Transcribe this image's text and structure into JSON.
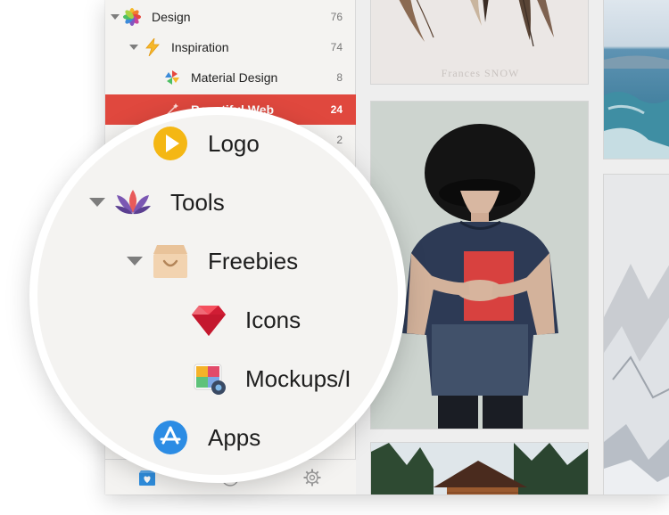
{
  "sidebar": {
    "items": [
      {
        "label": "Design",
        "count": "76",
        "icon": "photos-flower-icon"
      },
      {
        "label": "Inspiration",
        "count": "74",
        "icon": "lightning-icon"
      },
      {
        "label": "Material Design",
        "count": "8",
        "icon": "pinwheel-icon"
      },
      {
        "label": "Beautiful Web",
        "count": "24",
        "icon": "wand-icon",
        "selected": true
      },
      {
        "label": "",
        "count": "2",
        "icon": ""
      }
    ],
    "tabs": [
      {
        "name": "favorites-tab",
        "icon": "heart-box-icon"
      },
      {
        "name": "downloads-tab",
        "icon": "download-circle-icon"
      },
      {
        "name": "settings-tab",
        "icon": "gear-icon"
      }
    ]
  },
  "magnifier": {
    "items": [
      {
        "label": "Logo",
        "icon": "play-circle-icon"
      },
      {
        "label": "Tools",
        "icon": "lotus-icon"
      },
      {
        "label": "Freebies",
        "icon": "shopping-bag-icon"
      },
      {
        "label": "Icons",
        "icon": "ruby-gem-icon"
      },
      {
        "label": "Mockups/I",
        "icon": "photo-camera-icon"
      },
      {
        "label": "Apps",
        "icon": "app-store-icon"
      }
    ]
  },
  "content": {
    "caption": "Frances SNOW"
  },
  "colors": {
    "selected": "#e0483e",
    "sidebar_bg": "#f4f3f1",
    "count": "#777777"
  }
}
